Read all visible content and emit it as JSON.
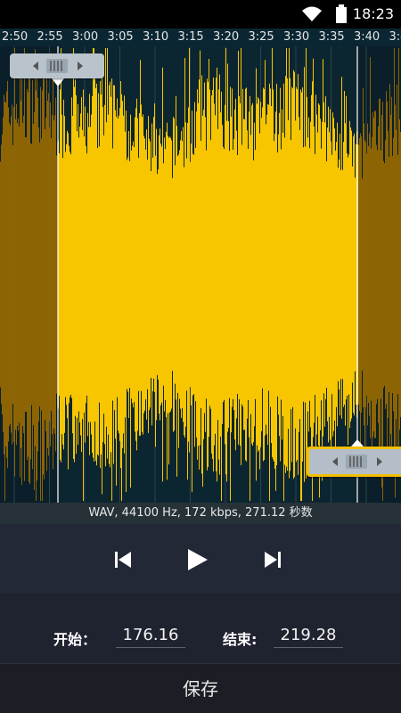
{
  "status_bar": {
    "time": "18:23"
  },
  "timeline": {
    "ticks": [
      "2:50",
      "2:55",
      "3:00",
      "3:05",
      "3:10",
      "3:15",
      "3:20",
      "3:25",
      "3:30",
      "3:35",
      "3:40",
      "3:4"
    ]
  },
  "info": {
    "text": "WAV, 44100 Hz, 172 kbps, 271.12 秒数"
  },
  "controls": {
    "prev_icon": "skip-previous-icon",
    "play_icon": "play-icon",
    "next_icon": "skip-next-icon"
  },
  "trim": {
    "start_label": "开始：",
    "start_value": "176.16",
    "end_label": "结束:",
    "end_value": "219.28"
  },
  "save": {
    "label": "保存"
  },
  "colors": {
    "wave_selected": "#f7c600",
    "wave_unselected": "#9a6c00",
    "background": "#0c2631",
    "accent": "#f2c000"
  }
}
